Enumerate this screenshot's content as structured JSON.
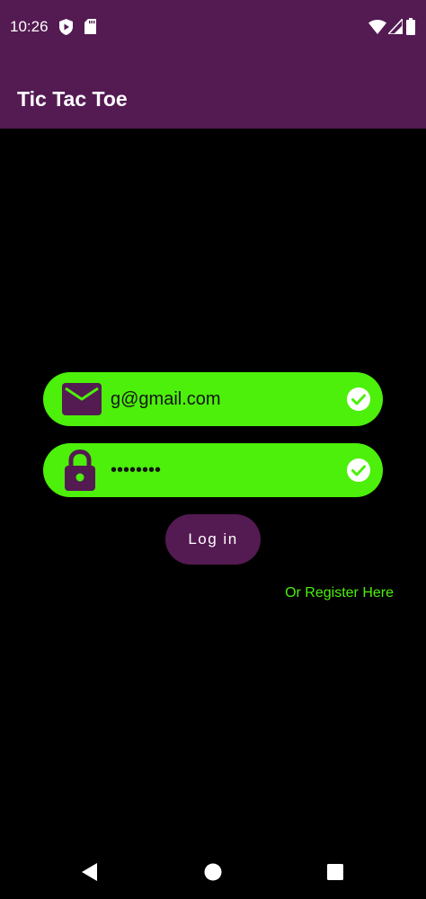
{
  "status_bar": {
    "time": "10:26",
    "icons": [
      "shield-play-icon",
      "sd-card-icon",
      "wifi-icon",
      "signal-icon",
      "battery-icon"
    ]
  },
  "app_bar": {
    "title": "Tic Tac Toe"
  },
  "login_form": {
    "email": {
      "value": "g@gmail.com",
      "icon": "mail-icon",
      "status_icon": "check-circle-icon"
    },
    "password": {
      "value": "12345678",
      "icon": "lock-icon",
      "status_icon": "check-circle-icon"
    },
    "login_label": "Log in",
    "register_label": "Or Register Here"
  },
  "nav_bar": {
    "buttons": [
      "back-icon",
      "home-icon",
      "recents-icon"
    ]
  },
  "colors": {
    "primary": "#541a52",
    "accent": "#4cf00a",
    "background": "#000000"
  }
}
